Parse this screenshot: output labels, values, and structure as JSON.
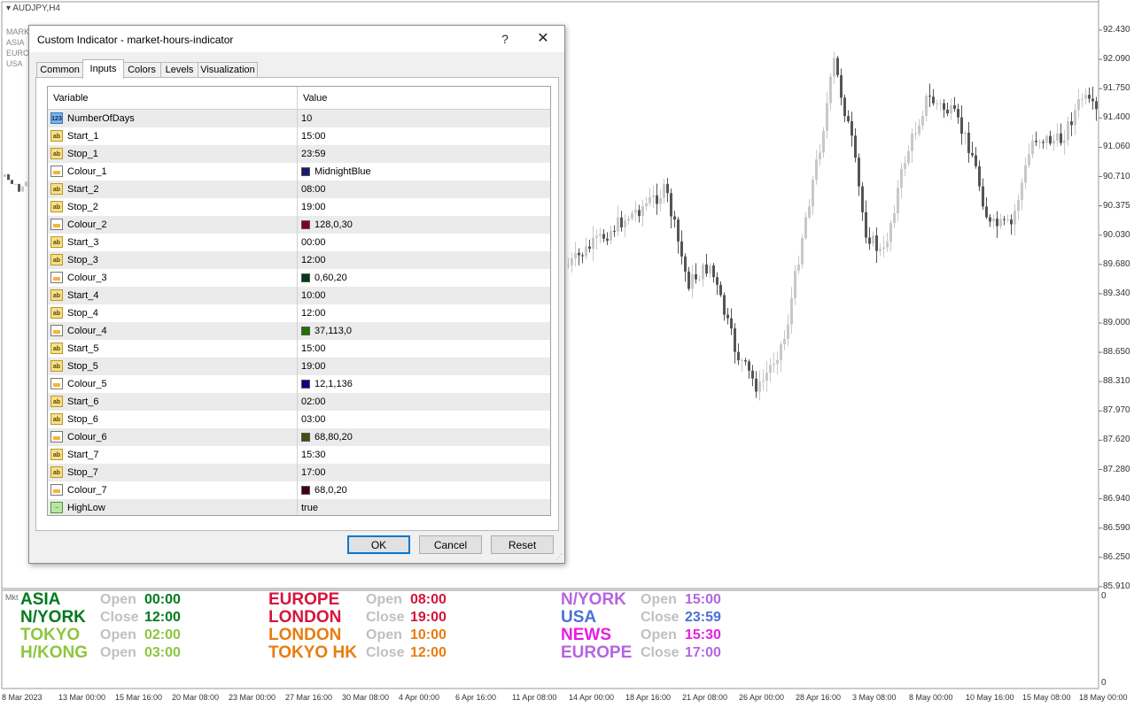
{
  "chart": {
    "symbol": "AUDJPY,H4",
    "legend_lines": [
      "MARK",
      "ASIA",
      "EURO",
      "USA"
    ],
    "price_axis": [
      "92.430",
      "92.090",
      "91.750",
      "91.400",
      "91.060",
      "90.710",
      "90.375",
      "90.030",
      "89.680",
      "89.340",
      "89.000",
      "88.650",
      "88.310",
      "87.970",
      "87.620",
      "87.280",
      "86.940",
      "86.590",
      "86.250",
      "85.910"
    ],
    "date_axis": [
      "8 Mar 2023",
      "13 Mar 00:00",
      "15 Mar 16:00",
      "20 Mar 08:00",
      "23 Mar 00:00",
      "27 Mar 16:00",
      "30 Mar 08:00",
      "4 Apr 00:00",
      "6 Apr 16:00",
      "11 Apr 08:00",
      "14 Apr 00:00",
      "18 Apr 16:00",
      "21 Apr 08:00",
      "26 Apr 00:00",
      "28 Apr 16:00",
      "3 May 08:00",
      "8 May 00:00",
      "10 May 16:00",
      "15 May 08:00",
      "18 May 00:00"
    ],
    "subwindow_tag": "Mkt",
    "subwindow_axis": [
      "0",
      "0"
    ]
  },
  "sessions": [
    {
      "name": "ASIA",
      "name_color": "#007a1e",
      "kw": "Open",
      "time": "00:00",
      "time_color": "#007a1e"
    },
    {
      "name": "N/YORK",
      "name_color": "#007a1e",
      "kw": "Close",
      "time": "12:00",
      "time_color": "#007a1e"
    },
    {
      "name": "TOKYO",
      "name_color": "#8dc63f",
      "kw": "Open",
      "time": "02:00",
      "time_color": "#8dc63f"
    },
    {
      "name": "H/KONG",
      "name_color": "#8dc63f",
      "kw": "Open",
      "time": "03:00",
      "time_color": "#8dc63f"
    },
    {
      "name": "EUROPE",
      "name_color": "#d6143c",
      "kw": "Open",
      "time": "08:00",
      "time_color": "#d6143c"
    },
    {
      "name": "LONDON",
      "name_color": "#d6143c",
      "kw": "Close",
      "time": "19:00",
      "time_color": "#d6143c"
    },
    {
      "name": "LONDON",
      "name_color": "#e87c10",
      "kw": "Open",
      "time": "10:00",
      "time_color": "#e87c10"
    },
    {
      "name": "TOKYO HK",
      "name_color": "#e87c10",
      "kw": "Close",
      "time": "12:00",
      "time_color": "#e87c10"
    },
    {
      "name": "N/YORK",
      "name_color": "#b565e0",
      "kw": "Open",
      "time": "15:00",
      "time_color": "#b565e0"
    },
    {
      "name": "USA",
      "name_color": "#4b6fd9",
      "kw": "Close",
      "time": "23:59",
      "time_color": "#4b6fd9"
    },
    {
      "name": "NEWS",
      "name_color": "#e61ee6",
      "kw": "Open",
      "time": "15:30",
      "time_color": "#e61ee6"
    },
    {
      "name": "EUROPE",
      "name_color": "#b565e0",
      "kw": "Close",
      "time": "17:00",
      "time_color": "#b565e0"
    }
  ],
  "dialog": {
    "title": "Custom Indicator - market-hours-indicator",
    "help": "?",
    "close": "✕",
    "tabs": [
      "Common",
      "Inputs",
      "Colors",
      "Levels",
      "Visualization"
    ],
    "active_tab": "Inputs",
    "columns": {
      "variable": "Variable",
      "value": "Value"
    },
    "params": [
      {
        "name": "NumberOfDays",
        "value": "10",
        "type": "int"
      },
      {
        "name": "Start_1",
        "value": "15:00",
        "type": "str"
      },
      {
        "name": "Stop_1",
        "value": "23:59",
        "type": "str"
      },
      {
        "name": "Colour_1",
        "value": "MidnightBlue",
        "type": "col",
        "color": "#191970"
      },
      {
        "name": "Start_2",
        "value": "08:00",
        "type": "str"
      },
      {
        "name": "Stop_2",
        "value": "19:00",
        "type": "str"
      },
      {
        "name": "Colour_2",
        "value": "128,0,30",
        "type": "col",
        "color": "#80001e"
      },
      {
        "name": "Start_3",
        "value": "00:00",
        "type": "str"
      },
      {
        "name": "Stop_3",
        "value": "12:00",
        "type": "str"
      },
      {
        "name": "Colour_3",
        "value": "0,60,20",
        "type": "col",
        "color": "#003c14"
      },
      {
        "name": "Start_4",
        "value": "10:00",
        "type": "str"
      },
      {
        "name": "Stop_4",
        "value": "12:00",
        "type": "str"
      },
      {
        "name": "Colour_4",
        "value": "37,113,0",
        "type": "col",
        "color": "#257100"
      },
      {
        "name": "Start_5",
        "value": "15:00",
        "type": "str"
      },
      {
        "name": "Stop_5",
        "value": "19:00",
        "type": "str"
      },
      {
        "name": "Colour_5",
        "value": "12,1,136",
        "type": "col",
        "color": "#0c0188"
      },
      {
        "name": "Start_6",
        "value": "02:00",
        "type": "str"
      },
      {
        "name": "Stop_6",
        "value": "03:00",
        "type": "str"
      },
      {
        "name": "Colour_6",
        "value": "68,80,20",
        "type": "col",
        "color": "#445014"
      },
      {
        "name": "Start_7",
        "value": "15:30",
        "type": "str"
      },
      {
        "name": "Stop_7",
        "value": "17:00",
        "type": "str"
      },
      {
        "name": "Colour_7",
        "value": "68,0,20",
        "type": "col",
        "color": "#440014"
      },
      {
        "name": "HighLow",
        "value": "true",
        "type": "bool"
      }
    ],
    "buttons": {
      "ok": "OK",
      "cancel": "Cancel",
      "reset": "Reset"
    }
  }
}
